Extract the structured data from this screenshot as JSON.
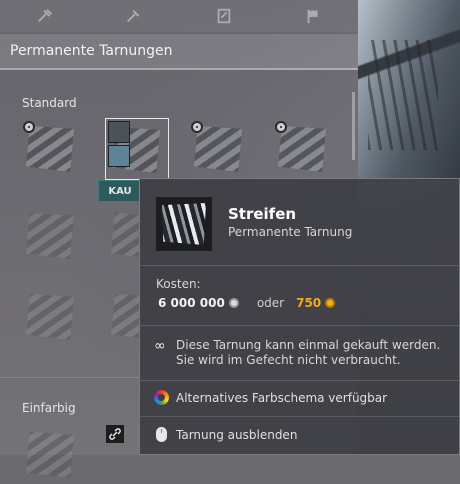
{
  "tabs": [
    {
      "icon": "hammer-icon"
    },
    {
      "icon": "hammer-icon"
    },
    {
      "icon": "paint-icon"
    },
    {
      "icon": "flag-icon"
    }
  ],
  "section": {
    "title": "Permanente Tarnungen"
  },
  "groups": {
    "standard": "Standard",
    "einfarbig": "Einfarbig"
  },
  "buy_button": "KAU",
  "tooltip": {
    "title": "Streifen",
    "subtitle": "Permanente Tarnung",
    "cost_label": "Kosten:",
    "credits": "6 000 000",
    "or": "oder",
    "gold": "750",
    "note_line1": "Diese Tarnung kann einmal gekauft werden.",
    "note_line2": "Sie wird im Gefecht nicht verbraucht.",
    "alt_scheme": "Alternatives Farbschema verfügbar",
    "hide": "Tarnung ausblenden",
    "infinity": "∞"
  },
  "colors": {
    "buy_button": "#2f5a5c",
    "gold": "#f4a91c",
    "swatch_dark": "#4a535a",
    "swatch_blue": "#5e8397"
  }
}
